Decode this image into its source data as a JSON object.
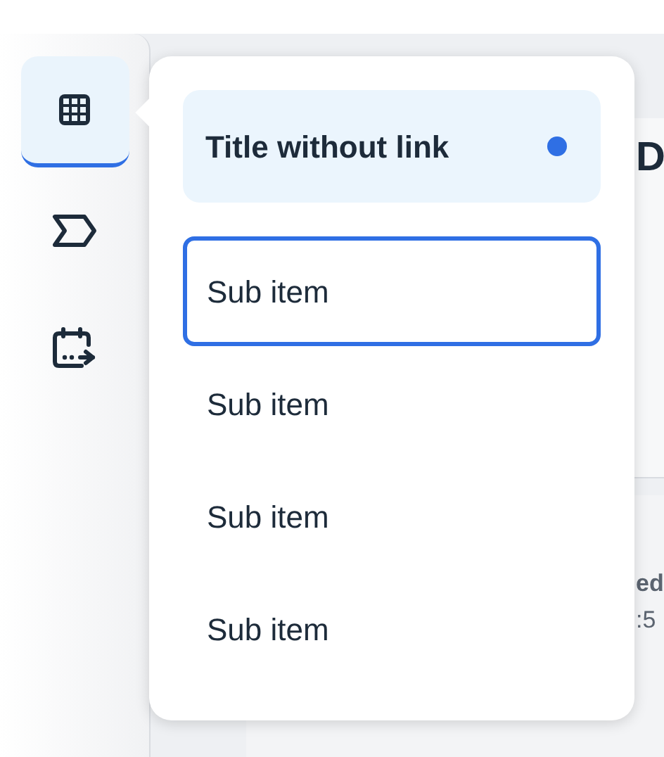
{
  "sidebar": {
    "items": [
      {
        "kind": "grid",
        "selected": true
      },
      {
        "kind": "tag",
        "selected": false
      },
      {
        "kind": "calendar",
        "selected": false
      }
    ]
  },
  "background": {
    "heading": "D",
    "status": "ed",
    "time": ":5"
  },
  "popover": {
    "title": "Title without link",
    "title_dot": true,
    "items": [
      {
        "label": "Sub item",
        "selected": true
      },
      {
        "label": "Sub item",
        "selected": false
      },
      {
        "label": "Sub item",
        "selected": false
      },
      {
        "label": "Sub item",
        "selected": false
      }
    ]
  }
}
